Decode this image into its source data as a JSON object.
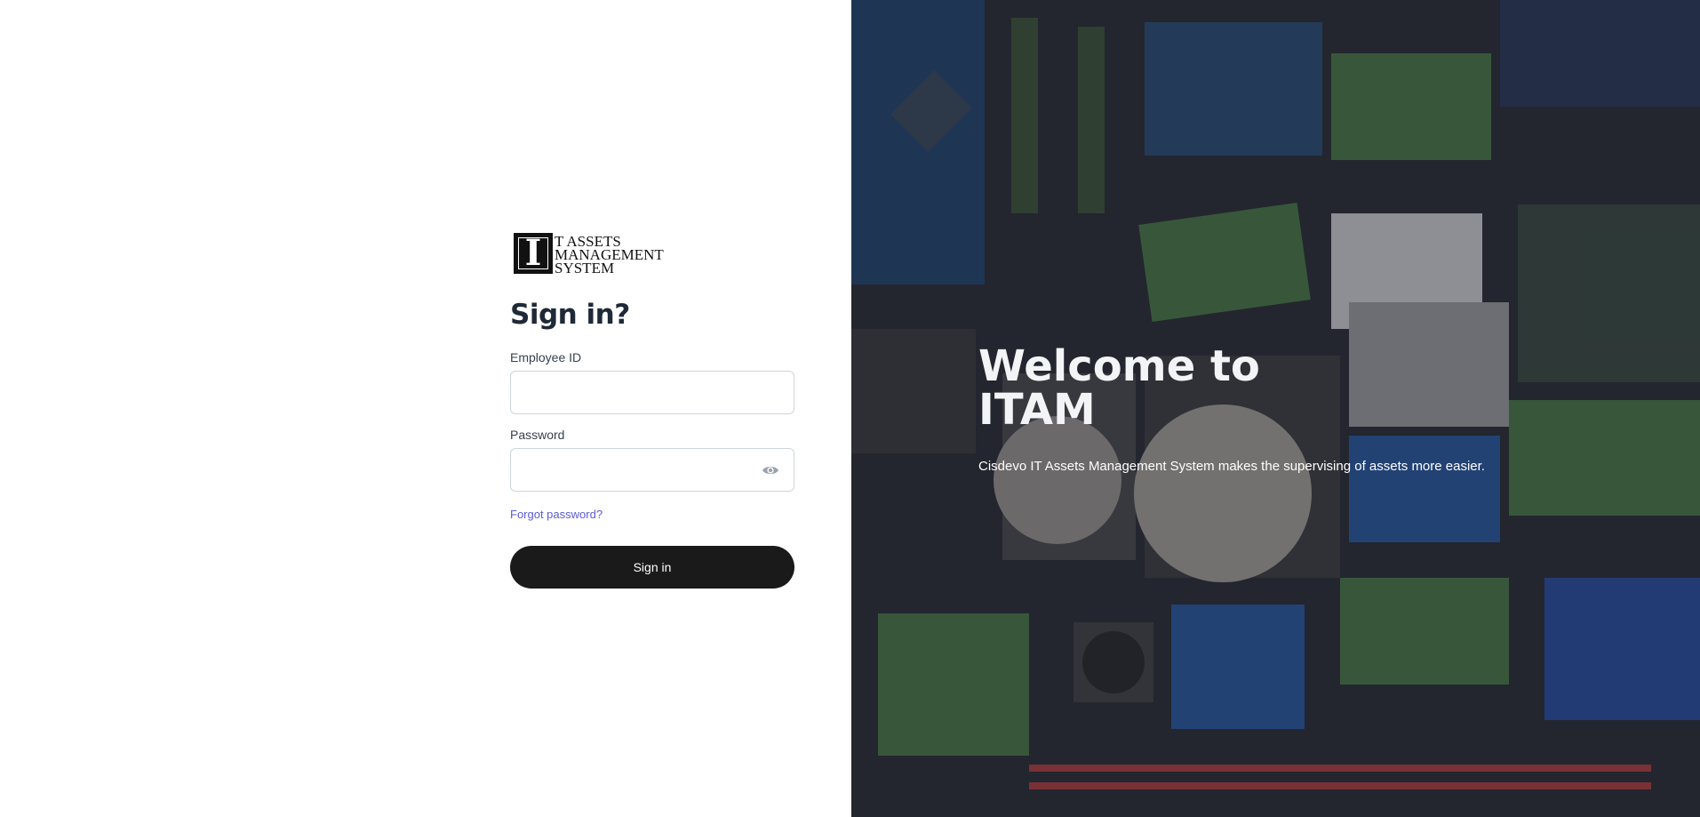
{
  "logo": {
    "mark_letter": "I",
    "text_lines": [
      "T ASSETS",
      "MANAGEMENT",
      "SYSTEM"
    ],
    "icon": "itam-logo"
  },
  "form": {
    "title": "Sign in?",
    "employee_id": {
      "label": "Employee ID",
      "value": "",
      "placeholder": ""
    },
    "password": {
      "label": "Password",
      "value": "",
      "placeholder": "",
      "toggle_icon": "eye-icon"
    },
    "forgot_link": "Forgot password?",
    "submit_label": "Sign in"
  },
  "hero": {
    "title_line1": "Welcome to",
    "title_line2": "ITAM",
    "subtitle": "Cisdevo IT Assets Management System makes the supervising of assets more easier."
  },
  "colors": {
    "button_bg": "#1a1a1a",
    "link": "#5b5bd6",
    "title": "#1f2937",
    "input_border": "#cfd4dc",
    "hero_bg": "#2a2d33"
  }
}
